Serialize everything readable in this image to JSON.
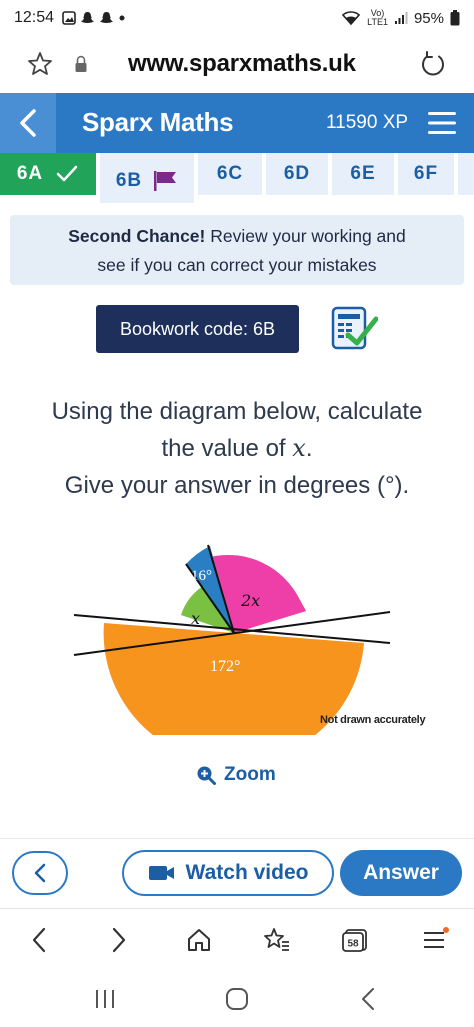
{
  "status_bar": {
    "time": "12:54",
    "signal_label_top": "Vo)",
    "signal_label_bottom": "LTE1",
    "battery": "95%"
  },
  "browser": {
    "url": "www.sparxmaths.uk"
  },
  "header": {
    "title": "Sparx Maths",
    "xp": "11590 XP"
  },
  "tabs": [
    {
      "label": "6A"
    },
    {
      "label": "6B"
    },
    {
      "label": "6C"
    },
    {
      "label": "6D"
    },
    {
      "label": "6E"
    },
    {
      "label": "6F"
    }
  ],
  "banner": {
    "bold": "Second Chance!",
    "rest_line1": " Review your working and",
    "line2": "see if you can correct your mistakes"
  },
  "bookwork": {
    "label": "Bookwork code: 6B"
  },
  "question": {
    "line1": "Using the diagram below, calculate",
    "line2_prefix": "the value of ",
    "variable": "x",
    "line2_suffix": ".",
    "line3": "Give your answer in degrees (°)."
  },
  "diagram": {
    "angle_top": "16°",
    "angle_left": "x",
    "angle_right": "2x",
    "angle_bottom": "172°",
    "note": "Not drawn accurately",
    "colors": {
      "blue": "#2a7fc4",
      "green": "#79c043",
      "pink": "#ee3fa8",
      "orange": "#f7941d"
    }
  },
  "zoom": {
    "label": "Zoom"
  },
  "actions": {
    "video_label": "Watch video",
    "answer_label": "Answer"
  },
  "browser_nav": {
    "tabs_count": "58"
  },
  "colors": {
    "primary": "#2b78c5",
    "done": "#22a35a",
    "bookwork_bg": "#1e2f5c"
  }
}
